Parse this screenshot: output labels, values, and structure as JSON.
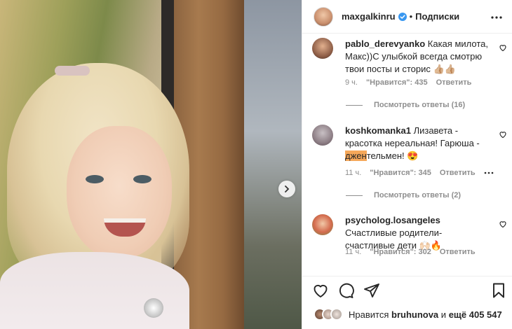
{
  "header": {
    "username": "maxgalkinru",
    "separator": "•",
    "follow_label": "Подписки"
  },
  "comments": [
    {
      "username": "pablo_derevyanko",
      "text": "Какая милота, Макс))С улыбкой всегда смотрю твои посты и сторис 👍🏼👍🏼",
      "time": "9 ч.",
      "likes": "\"Нравится\": 435",
      "reply": "Ответить",
      "view_replies": "Посмотреть ответы (16)"
    },
    {
      "username": "koshkomanka1",
      "text_before": "Лизавета - красотка нереальная! Гарюша - ",
      "text_highlight": "джен",
      "text_after": "тельмен! 😍",
      "time": "11 ч.",
      "likes": "\"Нравится\": 345",
      "reply": "Ответить",
      "view_replies": "Посмотреть ответы (2)"
    },
    {
      "username": "psycholog.losangeles",
      "text": "Счастливые родители- счастливые дети 🙌🏻🔥",
      "time": "11 ч.",
      "likes": "\"Нравится\": 302",
      "reply": "Ответить"
    }
  ],
  "likes_row": {
    "prefix": "Нравится",
    "user": "bruhunova",
    "middle": "и",
    "others": "ещё 405 547"
  },
  "icons": [
    "verified-badge-icon",
    "more-icon",
    "heart-icon",
    "comment-icon",
    "share-icon",
    "bookmark-icon",
    "chevron-right-icon"
  ],
  "colors": {
    "verified": "#3897f0",
    "highlight": "#f6a85a",
    "meta": "#8e8e8e"
  }
}
